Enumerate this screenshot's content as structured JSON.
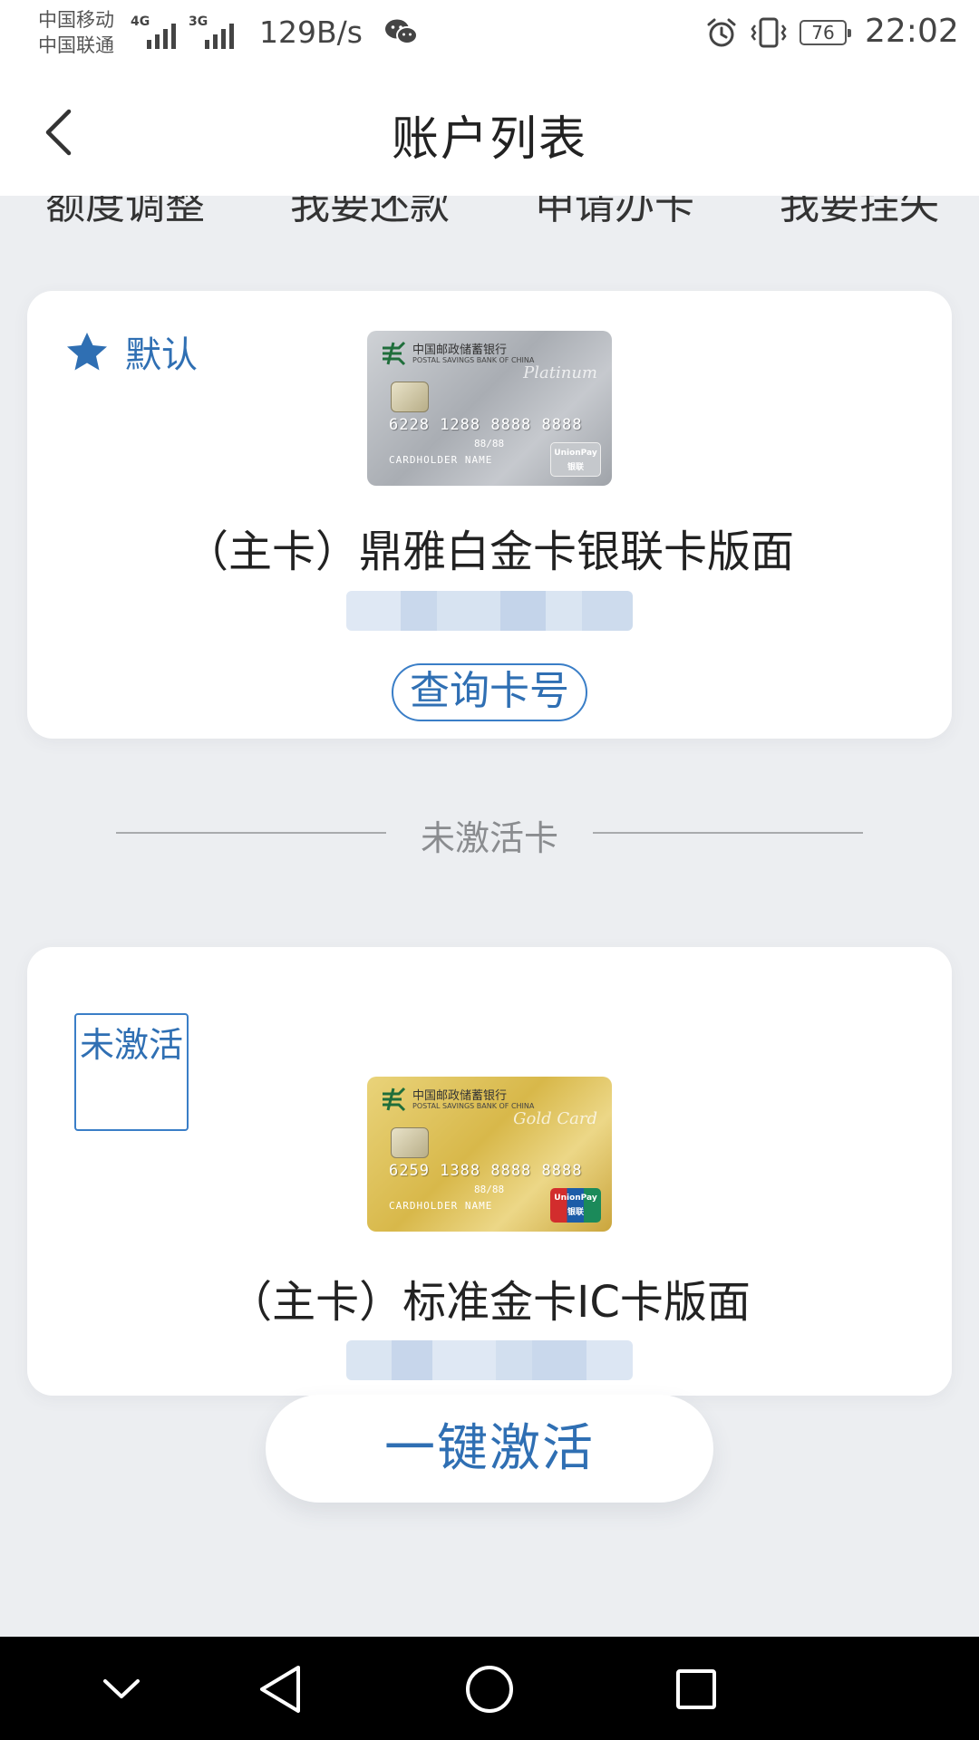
{
  "status_bar": {
    "carrier_1": "中国移动",
    "carrier_2": "中国联通",
    "signal_1_tag": "4G",
    "signal_2_tag": "3G",
    "net_speed": "129B/s",
    "battery": "76",
    "time": "22:02",
    "icons": [
      "wechat-icon",
      "alarm-icon",
      "vibrate-icon",
      "battery-icon"
    ]
  },
  "header": {
    "title": "账户列表",
    "back_icon": "chevron-left-icon"
  },
  "quick_actions": [
    "额度调整",
    "我要还款",
    "申请办卡",
    "我要挂失"
  ],
  "cards": [
    {
      "badge_label": "默认",
      "badge_icon": "star-icon",
      "image": {
        "bank_cn": "中国邮政储蓄银行",
        "bank_en": "POSTAL SAVINGS BANK OF CHINA",
        "tier": "Platinum",
        "number": "6228 1288 8888 8888",
        "valid": "88/88",
        "holder": "CARDHOLDER NAME",
        "network": "UnionPay",
        "network_cn": "银联"
      },
      "name": "（主卡）鼎雅白金卡银联卡版面",
      "action_label": "查询卡号"
    },
    {
      "badge_label": "未激活",
      "image": {
        "bank_cn": "中国邮政储蓄银行",
        "bank_en": "POSTAL SAVINGS BANK OF CHINA",
        "tier": "Gold Card",
        "number": "6259 1388 8888 8888",
        "valid": "88/88",
        "holder": "CARDHOLDER NAME",
        "network": "UnionPay",
        "network_cn": "银联"
      },
      "name": "（主卡）标准金卡IC卡版面"
    }
  ],
  "divider_label": "未激活卡",
  "activate_label": "一键激活",
  "nav_bar": {
    "icons": [
      "chevron-down-icon",
      "back-triangle-icon",
      "home-circle-icon",
      "recents-square-icon"
    ]
  },
  "colors": {
    "accent": "#2f6fb3",
    "background": "#eceef1",
    "card": "#ffffff",
    "nav_bar": "#000000"
  }
}
